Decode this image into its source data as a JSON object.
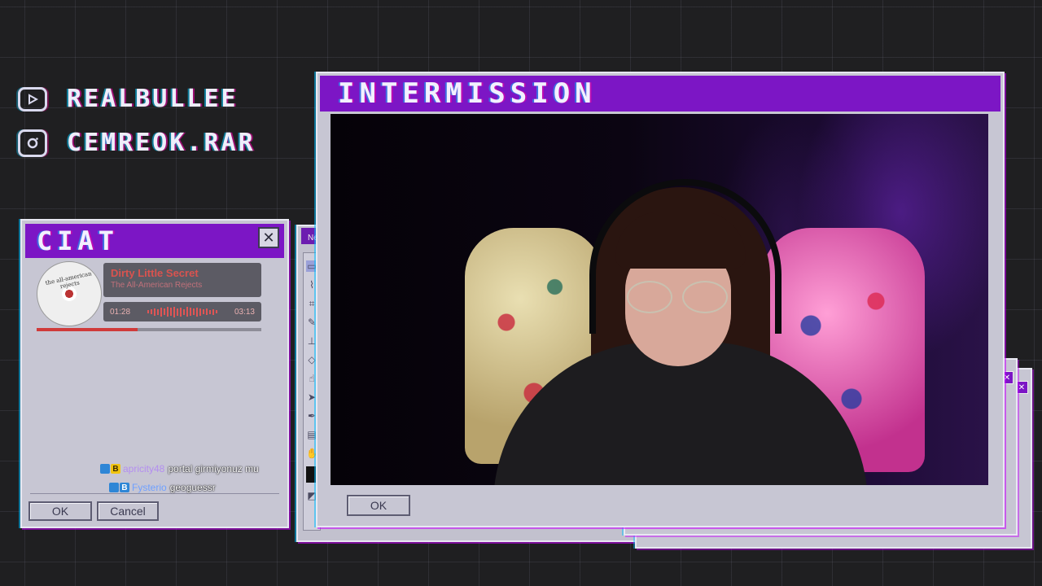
{
  "socials": [
    {
      "icon": "youtube-icon",
      "handle": "REALBULLEE"
    },
    {
      "icon": "instagram-icon",
      "handle": "CEMREOK.RAR"
    }
  ],
  "chat_window": {
    "title": "CIAT",
    "close_label": "✕",
    "ok_label": "OK",
    "cancel_label": "Cancel",
    "now_playing": {
      "track": "Dirty Little Secret",
      "artist": "The All-American Rejects",
      "elapsed": "01:28",
      "duration": "03:13",
      "progress": 0.45,
      "disc_text": "the all-american rejects"
    },
    "messages": [
      {
        "user": "apricity48",
        "user_color": "#b48ef0",
        "text": "portal girmiyonuz mu"
      },
      {
        "user": "Fysterio",
        "user_color": "#6fa0ff",
        "text": "geoguessr"
      }
    ]
  },
  "paint_window": {
    "title": "Ne"
  },
  "main_window": {
    "title": "INTERMISSION",
    "ok_label": "OK"
  },
  "colors": {
    "accent_purple": "#7c16c5",
    "window_gray": "#c7c6d3",
    "background": "#1f1f21"
  }
}
